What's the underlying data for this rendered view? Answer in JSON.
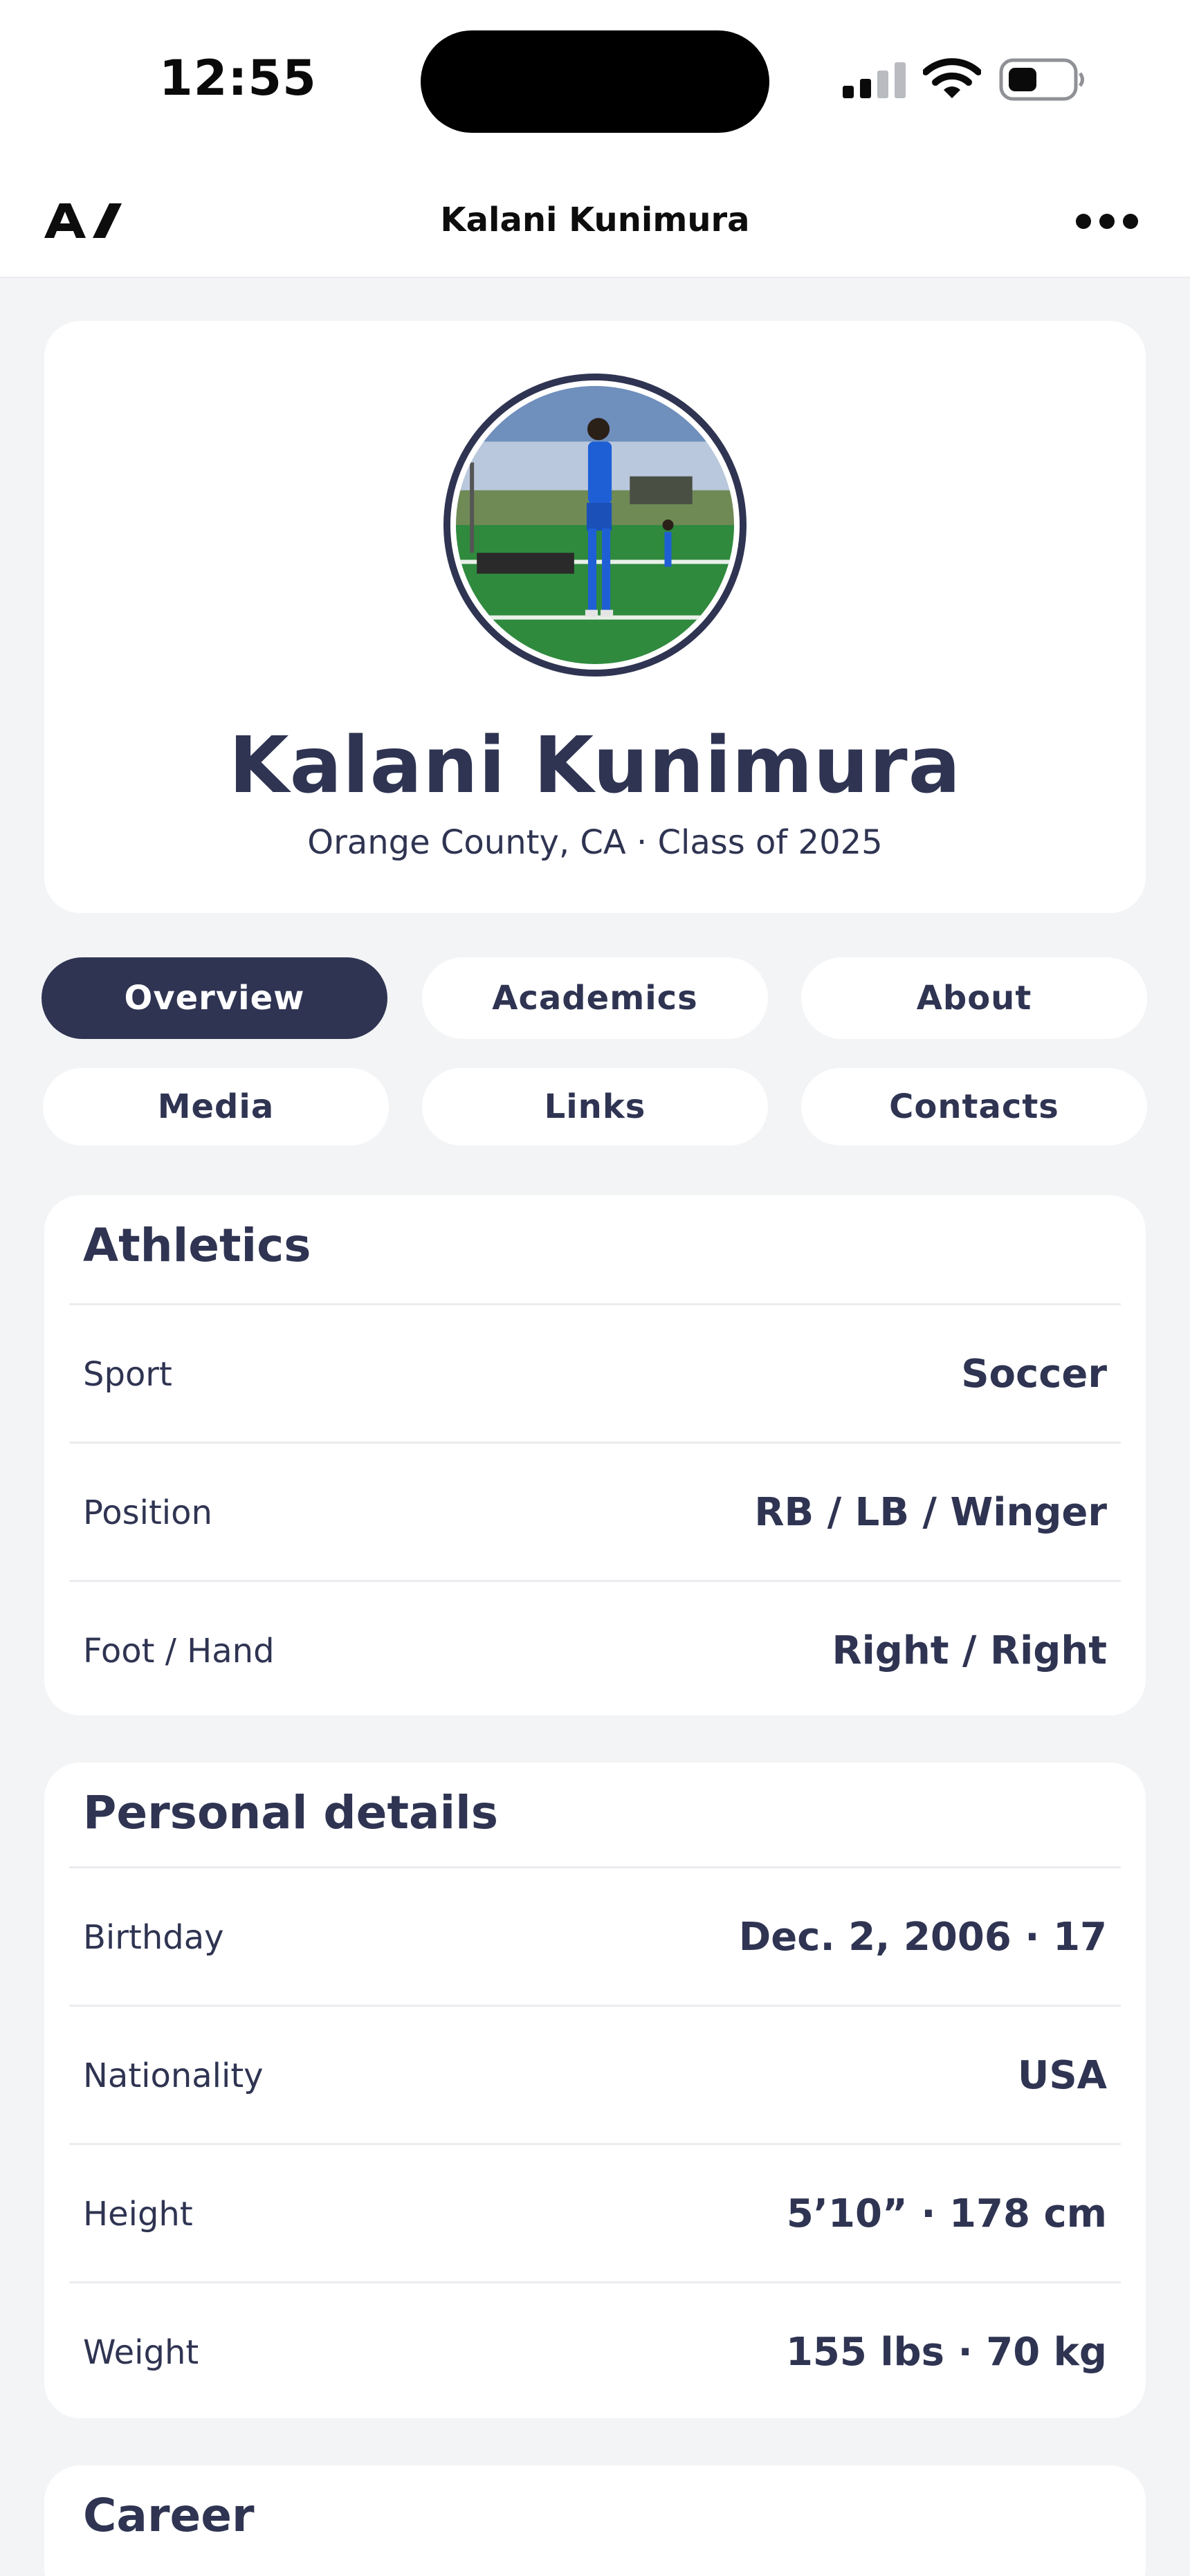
{
  "status_bar": {
    "time": "12:55",
    "icons": [
      "cellular-signal-icon",
      "wifi-icon",
      "battery-icon"
    ]
  },
  "nav": {
    "logo_icon": "brand-logo-icon",
    "title": "Kalani Kunimura",
    "more_icon": "more-dots-icon"
  },
  "profile": {
    "name": "Kalani Kunimura",
    "subtitle": "Orange County, CA · Class of 2025"
  },
  "tabs": [
    {
      "label": "Overview",
      "active": true
    },
    {
      "label": "Academics",
      "active": false
    },
    {
      "label": "About",
      "active": false
    },
    {
      "label": "Media",
      "active": false
    },
    {
      "label": "Links",
      "active": false
    },
    {
      "label": "Contacts",
      "active": false
    }
  ],
  "athletics": {
    "title": "Athletics",
    "rows": [
      {
        "label": "Sport",
        "value": "Soccer"
      },
      {
        "label": "Position",
        "value": "RB / LB / Winger"
      },
      {
        "label": "Foot / Hand",
        "value": "Right / Right"
      }
    ]
  },
  "personal": {
    "title": "Personal details",
    "rows": [
      {
        "label": "Birthday",
        "value": "Dec. 2, 2006 · 17"
      },
      {
        "label": "Nationality",
        "value": "USA"
      },
      {
        "label": "Height",
        "value": "5’10” · 178 cm"
      },
      {
        "label": "Weight",
        "value": "155 lbs · 70 kg"
      }
    ]
  },
  "career": {
    "title": "Career"
  },
  "colors": {
    "primary": "#2f3452",
    "background": "#f3f4f6",
    "card": "#ffffff"
  }
}
